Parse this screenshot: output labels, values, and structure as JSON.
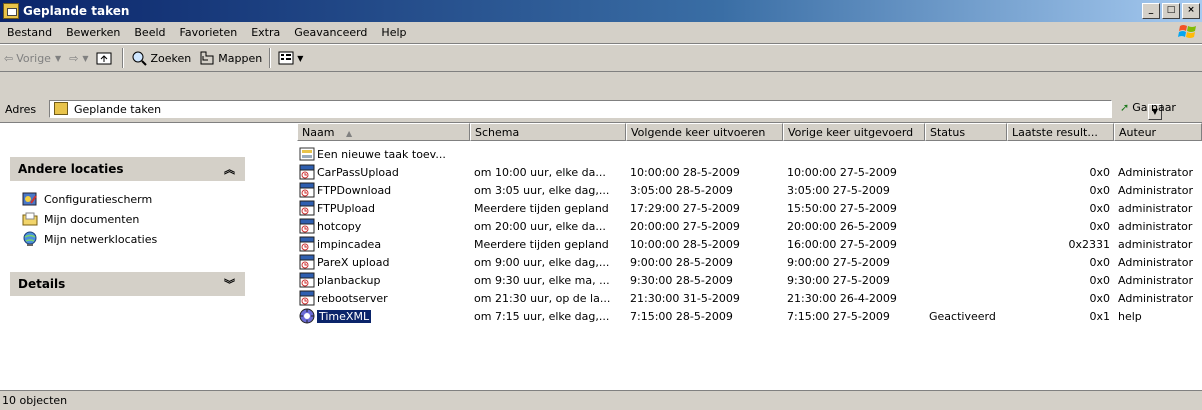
{
  "window": {
    "title": "Geplande taken"
  },
  "menu": [
    "Bestand",
    "Bewerken",
    "Beeld",
    "Favorieten",
    "Extra",
    "Geavanceerd",
    "Help"
  ],
  "toolbar": {
    "back": "Vorige",
    "search": "Zoeken",
    "folders": "Mappen"
  },
  "address": {
    "label": "Adres",
    "value": "Geplande taken",
    "go": "Ga naar"
  },
  "taskpane": {
    "other_locations": {
      "title": "Andere locaties",
      "links": [
        "Configuratiescherm",
        "Mijn documenten",
        "Mijn netwerklocaties"
      ]
    },
    "details": {
      "title": "Details"
    }
  },
  "columns": [
    "Naam",
    "Schema",
    "Volgende keer uitvoeren",
    "Vorige keer uitgevoerd",
    "Status",
    "Laatste result...",
    "Auteur"
  ],
  "rows": [
    {
      "name": "Een nieuwe taak toev...",
      "schedule": "",
      "next": "",
      "prev": "",
      "status": "",
      "result": "",
      "author": ""
    },
    {
      "name": "CarPassUpload",
      "schedule": "om 10:00 uur, elke da...",
      "next": "10:00:00  28-5-2009",
      "prev": "10:00:00  27-5-2009",
      "status": "",
      "result": "0x0",
      "author": "Administrator"
    },
    {
      "name": "FTPDownload",
      "schedule": "om 3:05 uur, elke dag,...",
      "next": "3:05:00  28-5-2009",
      "prev": "3:05:00  27-5-2009",
      "status": "",
      "result": "0x0",
      "author": "Administrator"
    },
    {
      "name": "FTPUpload",
      "schedule": "Meerdere tijden gepland",
      "next": "17:29:00  27-5-2009",
      "prev": "15:50:00  27-5-2009",
      "status": "",
      "result": "0x0",
      "author": "administrator"
    },
    {
      "name": "hotcopy",
      "schedule": "om 20:00 uur, elke da...",
      "next": "20:00:00  27-5-2009",
      "prev": "20:00:00  26-5-2009",
      "status": "",
      "result": "0x0",
      "author": "administrator"
    },
    {
      "name": "impincadea",
      "schedule": "Meerdere tijden gepland",
      "next": "10:00:00  28-5-2009",
      "prev": "16:00:00  27-5-2009",
      "status": "",
      "result": "0x2331",
      "author": "administrator"
    },
    {
      "name": "PareX upload",
      "schedule": "om 9:00 uur, elke dag,...",
      "next": "9:00:00  28-5-2009",
      "prev": "9:00:00  27-5-2009",
      "status": "",
      "result": "0x0",
      "author": "Administrator"
    },
    {
      "name": "planbackup",
      "schedule": "om 9:30 uur, elke ma, ...",
      "next": "9:30:00  28-5-2009",
      "prev": "9:30:00  27-5-2009",
      "status": "",
      "result": "0x0",
      "author": "Administrator"
    },
    {
      "name": "rebootserver",
      "schedule": "om 21:30 uur, op de la...",
      "next": "21:30:00  31-5-2009",
      "prev": "21:30:00  26-4-2009",
      "status": "",
      "result": "0x0",
      "author": "Administrator"
    },
    {
      "name": "TimeXML",
      "schedule": "om 7:15 uur, elke dag,...",
      "next": "7:15:00  28-5-2009",
      "prev": "7:15:00  27-5-2009",
      "status": "Geactiveerd",
      "result": "0x1",
      "author": "help",
      "selected": true
    }
  ],
  "statusbar": {
    "text": "10 objecten"
  }
}
